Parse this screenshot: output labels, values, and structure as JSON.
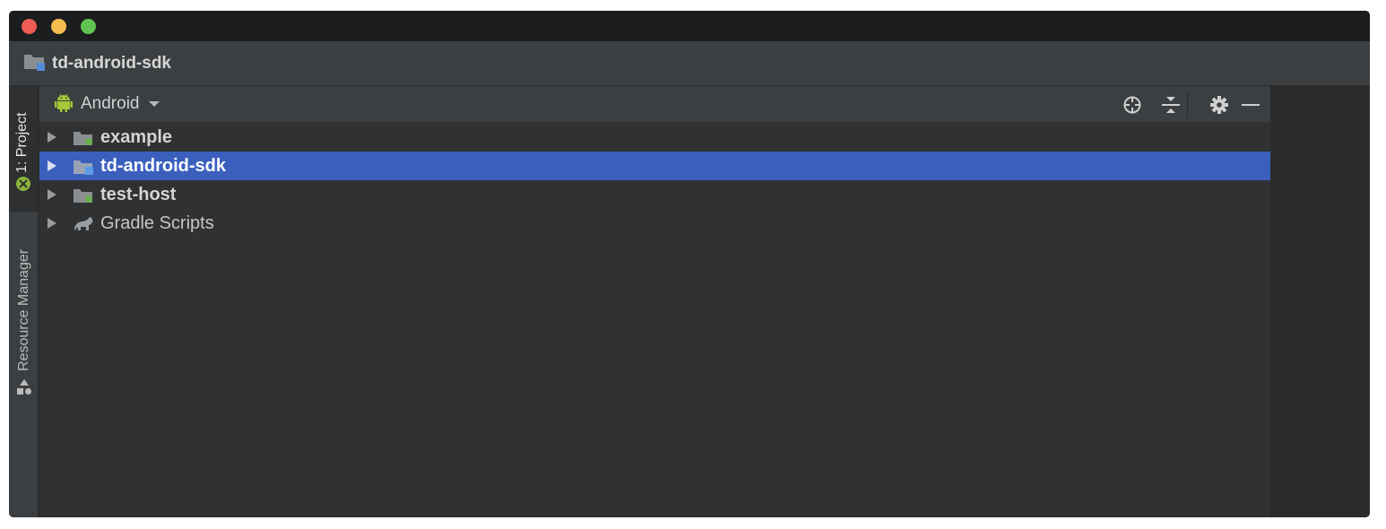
{
  "window": {
    "traffic_lights": [
      {
        "name": "close",
        "color": "#ee5c54"
      },
      {
        "name": "minimize",
        "color": "#f3be4f"
      },
      {
        "name": "maximize",
        "color": "#5fc453"
      }
    ]
  },
  "navbar": {
    "project_name": "td-android-sdk",
    "icon": "module-folder-icon"
  },
  "left_toolbar": {
    "tabs": [
      {
        "label": "1: Project",
        "icon": "android-project-icon",
        "active": true
      },
      {
        "label": "Resource Manager",
        "icon": "resource-manager-icon",
        "active": false
      }
    ]
  },
  "project_panel": {
    "view_selector": {
      "label": "Android",
      "icon": "android-icon"
    },
    "header_actions": [
      {
        "icon": "locate-crosshair-icon"
      },
      {
        "icon": "collapse-all-icon"
      },
      {
        "icon": "gear-icon"
      },
      {
        "icon": "minimize-icon"
      }
    ],
    "tree": [
      {
        "label": "example",
        "icon": "app-module-folder-icon",
        "selected": false,
        "bold": true
      },
      {
        "label": "td-android-sdk",
        "icon": "library-module-folder-icon",
        "selected": true,
        "bold": true
      },
      {
        "label": "test-host",
        "icon": "app-module-folder-icon",
        "selected": false,
        "bold": true
      },
      {
        "label": "Gradle Scripts",
        "icon": "gradle-elephant-icon",
        "selected": false,
        "bold": false
      }
    ]
  },
  "colors": {
    "selection": "#3a5fbd",
    "android_green": "#a4c639",
    "panel_bg": "#2f3133",
    "toolbar_bg": "#3c3f41"
  }
}
